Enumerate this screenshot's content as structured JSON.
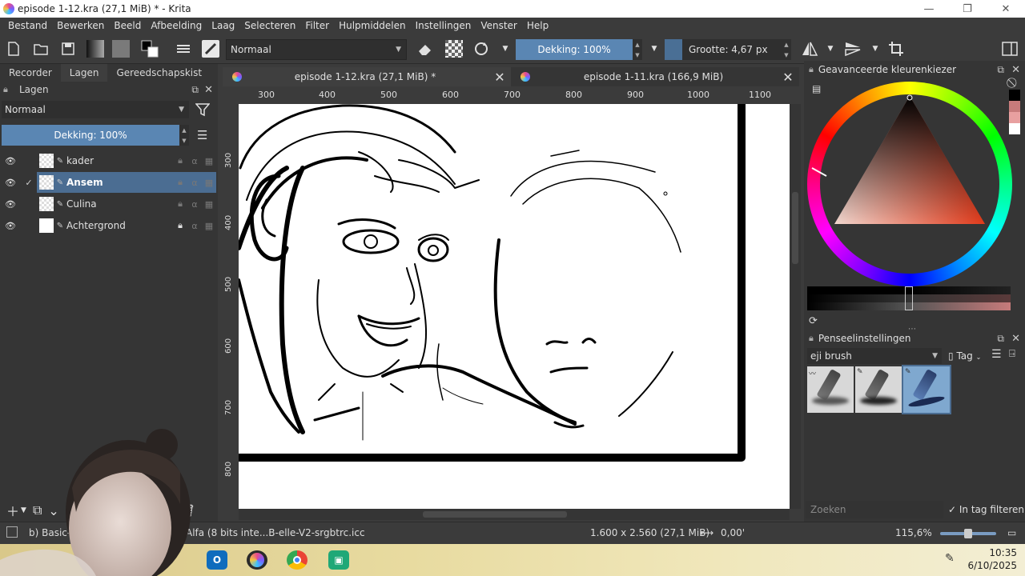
{
  "window": {
    "title": "episode 1-12.kra (27,1 MiB) * - Krita",
    "minimize": "—",
    "maximize": "❐",
    "close": "✕"
  },
  "menu": [
    "Bestand",
    "Bewerken",
    "Beeld",
    "Afbeelding",
    "Laag",
    "Selecteren",
    "Filter",
    "Hulpmiddelen",
    "Instellingen",
    "Venster",
    "Help"
  ],
  "toolbar": {
    "blend_mode": "Normaal",
    "opacity": "Dekking: 100%",
    "size": "Grootte: 4,67 px"
  },
  "left_tabs": [
    "Recorder",
    "Lagen",
    "Gereedschapskist"
  ],
  "layers_panel": {
    "title": "Lagen",
    "blend_mode": "Normaal",
    "opacity": "Dekking: 100%",
    "layers": [
      {
        "name": "kader",
        "selected": false,
        "locked": false
      },
      {
        "name": "Ansem",
        "selected": true,
        "locked": false
      },
      {
        "name": "Culina",
        "selected": false,
        "locked": false
      },
      {
        "name": "Achtergrond",
        "selected": false,
        "locked": true
      }
    ]
  },
  "doc_tabs": [
    {
      "name": "episode 1-12.kra (27,1 MiB) *",
      "active": true
    },
    {
      "name": "episode 1-11.kra (166,9 MiB)",
      "active": false
    }
  ],
  "ruler": {
    "top": [
      "300",
      "400",
      "500",
      "600",
      "700",
      "800",
      "900",
      "1000",
      "1100"
    ],
    "left": [
      "300",
      "400",
      "500",
      "600",
      "700",
      "800"
    ]
  },
  "color_panel": {
    "title": "Geavanceerde kleurenkiezer",
    "history": [
      "#000000",
      "#c77b7b",
      "#e8a0a0",
      "#ffffff"
    ]
  },
  "brush_panel": {
    "title": "Penseelinstellingen",
    "preset": "eji brush",
    "tag": "Tag",
    "search_placeholder": "Zoeken",
    "filter_label": "In tag filteren"
  },
  "status": {
    "brush": "b) Basic-1",
    "colorspace": "Alfa (8 bits inte...B-elle-V2-srgbtrc.icc",
    "dimensions": "1.600 x 2.560 (27,1 MiB)",
    "rotation": "0,00'",
    "zoom": "115,6%"
  },
  "taskbar": {
    "time": "10:35",
    "date": "6/10/2025"
  },
  "colors": {
    "accent": "#5a86b3",
    "selection": "#4b6d92",
    "panel": "#353535"
  }
}
